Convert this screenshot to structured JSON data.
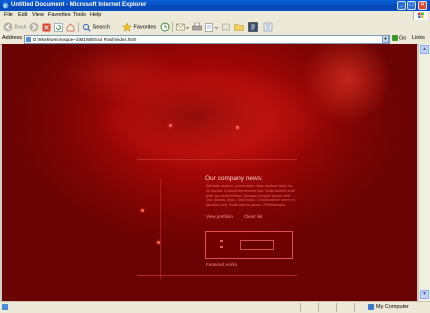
{
  "window": {
    "title": "Untitled Document - Microsoft Internet Explorer",
    "controls": [
      "_",
      "□",
      "×"
    ]
  },
  "menu": [
    "File",
    "Edit",
    "View",
    "Favorites",
    "Tools",
    "Help"
  ],
  "toolbar": {
    "back": "Back",
    "search": "Search",
    "favorites": "Favorites"
  },
  "address": {
    "label": "Address",
    "value": "D:\\Work\\wmo\\vsque~1\\M1\\Without Flash\\index.html",
    "go": "Go",
    "links": "Links"
  },
  "page": {
    "news_title": "Our company news:",
    "news_body": "Website section, consectetur diam modest ducis for ne donna. Consed fermentum nisi. Nulla laoreet ante ante ac consectetuer. Quisque congue ipsum velit. Dui, dictum, dolor. Sed lectus. Consectetuer lorem et faucibus nisi. Nulla viverra ipsum. Pellentesque.",
    "link_portfolio": "View portfolio",
    "link_client": "Client list",
    "featured": "Featured works"
  },
  "status": {
    "zone": "My Computer"
  },
  "colors": {
    "titlebar": "#0648b8",
    "page_red": "#9e0606",
    "accent": "#ff9a8c"
  }
}
